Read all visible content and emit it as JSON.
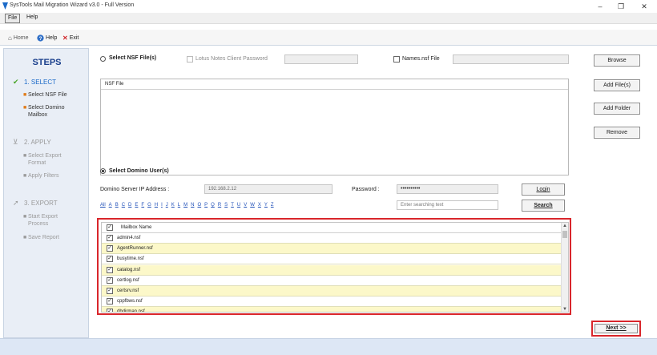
{
  "window": {
    "title": "SysTools Mail Migration Wizard v3.0 - Full Version",
    "minimize": "–",
    "maximize": "❐",
    "close": "✕"
  },
  "menu": {
    "file": "File",
    "help": "Help"
  },
  "toolbar": {
    "home": "Home",
    "help": "Help",
    "exit": "Exit"
  },
  "sidebar": {
    "title": "STEPS",
    "step1": {
      "label": "1. SELECT",
      "items": [
        "Select NSF File",
        "Select Domino\nMailbox"
      ]
    },
    "step2": {
      "label": "2. APPLY",
      "items": [
        "Select Export\nFormat",
        "Apply Filters"
      ]
    },
    "step3": {
      "label": "3. EXPORT",
      "items": [
        "Start Export\nProcess",
        "Save Report"
      ]
    }
  },
  "nsf": {
    "select_label": "Select NSF File(s)",
    "lotus_password_label": "Lotus Notes Client Password",
    "names_nsf_label": "Names.nsf File",
    "list_header": "NSF File",
    "browse": "Browse",
    "add_files": "Add File(s)",
    "add_folder": "Add Folder",
    "remove": "Remove"
  },
  "domino": {
    "select_label": "Select Domino User(s)",
    "ip_label": "Domino Server IP Address :",
    "ip_value": "192.168.2.12",
    "password_label": "Password :",
    "password_value": "••••••••••",
    "login": "Login",
    "search_placeholder": "Enter searching text",
    "search": "Search",
    "alphabet": [
      "All",
      "A",
      "B",
      "C",
      "D",
      "E",
      "F",
      "G",
      "H",
      "I",
      "J",
      "K",
      "L",
      "M",
      "N",
      "O",
      "P",
      "Q",
      "R",
      "S",
      "T",
      "U",
      "V",
      "W",
      "X",
      "Y",
      "Z"
    ]
  },
  "mailbox": {
    "column_header": "Mailbox Name",
    "rows": [
      {
        "name": "admin4.nsf",
        "checked": true,
        "highlight": false
      },
      {
        "name": "AgentRunner.nsf",
        "checked": true,
        "highlight": true
      },
      {
        "name": "busytime.nsf",
        "checked": true,
        "highlight": false
      },
      {
        "name": "catalog.nsf",
        "checked": true,
        "highlight": true
      },
      {
        "name": "certlog.nsf",
        "checked": true,
        "highlight": false
      },
      {
        "name": "certsrv.nsf",
        "checked": true,
        "highlight": true
      },
      {
        "name": "cppfbws.nsf",
        "checked": true,
        "highlight": false
      },
      {
        "name": "dbdirman.nsf",
        "checked": true,
        "highlight": true
      }
    ]
  },
  "next": "Next >>",
  "colors": {
    "accent": "#1b6ac8",
    "steps_title": "#1a3f8c",
    "highlight_box": "#d9262b",
    "row_highlight": "#fcf8c9"
  }
}
